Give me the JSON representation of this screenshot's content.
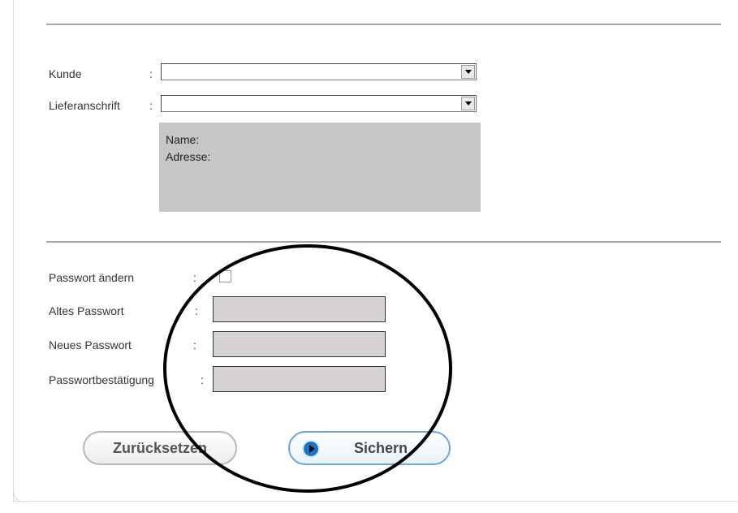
{
  "customer": {
    "label": "Kunde",
    "colon": ":",
    "value": ""
  },
  "delivery_address": {
    "label": "Lieferanschrift",
    "colon": ":",
    "value": ""
  },
  "address_box": {
    "name_label": "Name:",
    "address_label": "Adresse:"
  },
  "password": {
    "change_label": "Passwort ändern",
    "change_colon": ":",
    "change_checked": false,
    "old_label": "Altes Passwort",
    "old_colon": ":",
    "new_label": "Neues Passwort",
    "new_colon": ":",
    "confirm_label": "Passwortbestätigung",
    "confirm_colon": ":"
  },
  "buttons": {
    "reset_label": "Zurücksetzen",
    "save_label": "Sichern"
  },
  "icons": {
    "select_arrow": "chevron-down-icon",
    "save_icon": "play-icon"
  }
}
